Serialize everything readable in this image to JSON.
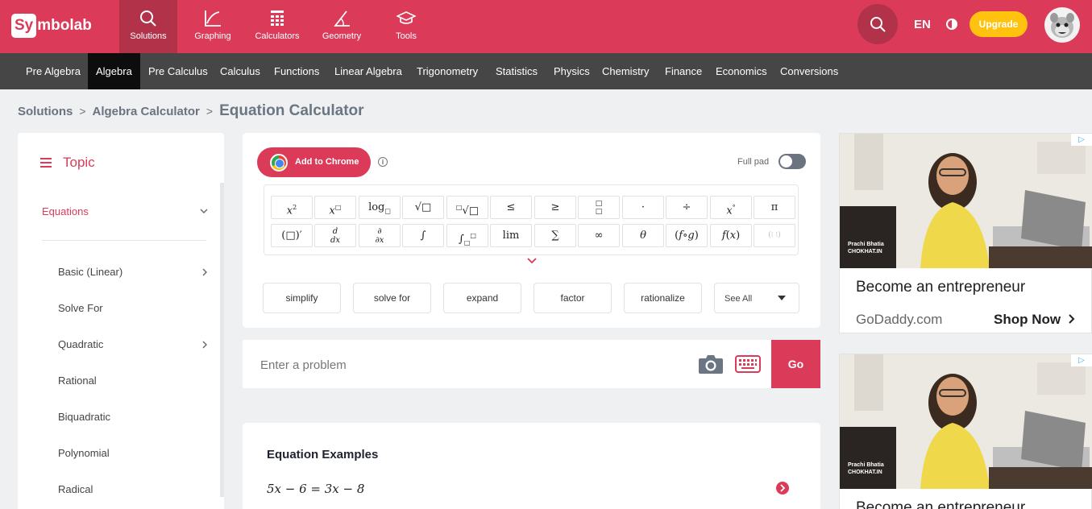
{
  "brand": {
    "logo_box": "Sy",
    "logo_rest": "mbolab",
    "accent": "#db3b59",
    "dark": "#464646"
  },
  "nav": [
    {
      "label": "Solutions",
      "icon": "search-icon",
      "active": true
    },
    {
      "label": "Graphing",
      "icon": "chart-line-icon"
    },
    {
      "label": "Calculators",
      "icon": "calculator-icon"
    },
    {
      "label": "Geometry",
      "icon": "angle-icon"
    },
    {
      "label": "Tools",
      "icon": "graduation-cap-icon"
    }
  ],
  "header": {
    "language": "EN",
    "upgrade": "Upgrade"
  },
  "subjects": [
    "Pre Algebra",
    "Algebra",
    "Pre Calculus",
    "Calculus",
    "Functions",
    "Linear Algebra",
    "Trigonometry",
    "Statistics",
    "Physics",
    "Chemistry",
    "Finance",
    "Economics",
    "Conversions"
  ],
  "breadcrumb": {
    "root": "Solutions",
    "sep": ">",
    "parent": "Algebra Calculator",
    "current": "Equation Calculator"
  },
  "sidebar": {
    "title": "Topic",
    "active_item": "Equations",
    "items": [
      "Basic (Linear)",
      "Solve For",
      "Quadratic",
      "Rational",
      "Biquadratic",
      "Polynomial",
      "Radical"
    ]
  },
  "keypad": {
    "add_to_chrome": "Add to Chrome",
    "full_pad": "Full pad",
    "operations": [
      "simplify",
      "solve for",
      "expand",
      "factor",
      "rationalize"
    ],
    "see_all": "See All"
  },
  "input": {
    "placeholder": "Enter a problem",
    "go": "Go"
  },
  "examples": {
    "title": "Equation Examples",
    "first": "5x − 6 = 3x − 8"
  },
  "ads": [
    {
      "badge": "▷",
      "caption_name": "Prachi Bhatia",
      "caption_org": "CHOKHAT.IN",
      "headline": "Become an entrepreneur",
      "domain": "GoDaddy.com",
      "cta": "Shop Now"
    },
    {
      "badge": "▷",
      "caption_name": "Prachi Bhatia",
      "caption_org": "CHOKHAT.IN",
      "headline": "Become an entrepreneur"
    }
  ]
}
